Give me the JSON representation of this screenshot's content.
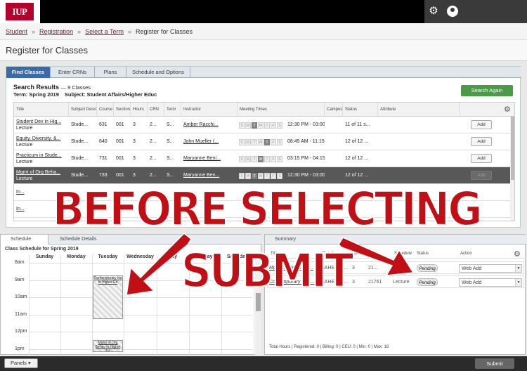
{
  "header": {
    "logo_text": "IUP",
    "icons": [
      "gear-icon",
      "user-icon"
    ]
  },
  "breadcrumb": {
    "items": [
      "Student",
      "Registration",
      "Select a Term",
      "Register for Classes"
    ],
    "separator": "»"
  },
  "page_title": "Register for Classes",
  "tabs": [
    "Find Classes",
    "Enter CRNs",
    "Plans",
    "Schedule and Options"
  ],
  "search": {
    "heading": "Search Results",
    "count": "— 9 Classes",
    "term_label": "Term: Spring 2019",
    "subject_label": "Subject: Student Affairs/Higher Educ",
    "search_again": "Search Again"
  },
  "grid": {
    "columns": [
      "Title",
      "Subject Descr",
      "Course",
      "Section",
      "Hours",
      "CRN",
      "Term",
      "Instructor",
      "Meeting Times",
      "Campus",
      "Status",
      "Attribute"
    ],
    "day_letters": [
      "S",
      "M",
      "T",
      "W",
      "T",
      "F",
      "S"
    ],
    "add_label": "Add",
    "rows": [
      {
        "title": "Student Dev in Hig...",
        "type": "Lecture",
        "subject": "Stude...",
        "course": "631",
        "section": "001",
        "hours": "3",
        "crn": "2...",
        "term": "S...",
        "instructor": "Amber Racchi...",
        "time": "12:30 PM - 03:00",
        "status": "11 of 11 s...",
        "days_on": [
          2
        ]
      },
      {
        "title": "Equity, Diversity, &...",
        "type": "Lecture",
        "subject": "Stude...",
        "course": "640",
        "section": "001",
        "hours": "3",
        "crn": "2...",
        "term": "S...",
        "instructor": "John Mueller (...",
        "time": "08:45 AM - 11:15",
        "status": "12 of 12 ...",
        "days_on": [
          4
        ]
      },
      {
        "title": "Practicum in Stude...",
        "type": "Lecture",
        "subject": "Stude...",
        "course": "731",
        "section": "001",
        "hours": "3",
        "crn": "2...",
        "term": "S...",
        "instructor": "Maryanne Beni...",
        "time": "03:15 PM - 04:15",
        "status": "12 of 12 ...",
        "days_on": [
          3
        ]
      },
      {
        "title": "Mgmt of Org Beha...",
        "type": "Lecture",
        "subject": "Stude...",
        "course": "733",
        "section": "001",
        "hours": "3",
        "crn": "2...",
        "term": "S...",
        "instructor": "Maryanne Ben...",
        "time": "12:30 PM - 03:00",
        "status": "12 of 12 ...",
        "days_on": [
          2
        ]
      }
    ],
    "partial_rows": [
      "In...",
      "In..."
    ]
  },
  "schedule": {
    "tabs": [
      "Schedule",
      "Schedule Details"
    ],
    "title": "Class Schedule for Spring 2019",
    "days": [
      "Sunday",
      "Monday",
      "Tuesday",
      "Wednesday",
      "Thursday",
      "Friday",
      "Saturday"
    ],
    "day_visible": [
      "Sunday",
      "Monday",
      "Tuesday",
      "Wednesday",
      "day",
      "Friday",
      "Saturday"
    ],
    "hours": [
      "8am",
      "9am",
      "10am",
      "11am",
      "12pm",
      "1pm"
    ],
    "blocks": [
      {
        "label": "Contemporary Iss in Higher Ed",
        "start_hour": 8.75,
        "end_hour": 11.25
      },
      {
        "label": "Mgmt of Org Behav in Higher Ed",
        "start_hour": 12.5,
        "end_hour": 13.2
      }
    ]
  },
  "summary": {
    "title": "Summary",
    "columns": [
      "Title",
      "Details",
      "Hours",
      "CRN",
      "Schedule",
      "Status",
      "Action"
    ],
    "rows": [
      {
        "title": "Mgmt of Org Beha...",
        "details": "SAHE 733...",
        "hours": "3",
        "crn": "21...",
        "schedule": "",
        "status": "Pending",
        "action": "Web Add"
      },
      {
        "title": "Contemporary Iss i...",
        "details": "SAHE 740...",
        "hours": "3",
        "crn": "21761",
        "schedule": "Lecture",
        "status": "Pending",
        "action": "Web Add"
      }
    ],
    "totals": "Total Hours | Registered: 0 | Billing: 0 | CEU: 0 | Min: 0 | Max: 18"
  },
  "footer": {
    "panels": "Panels",
    "submit": "Submit"
  },
  "overlay": {
    "banner": "BEFORE SELECTING SUBMIT",
    "color": "#c01016"
  }
}
